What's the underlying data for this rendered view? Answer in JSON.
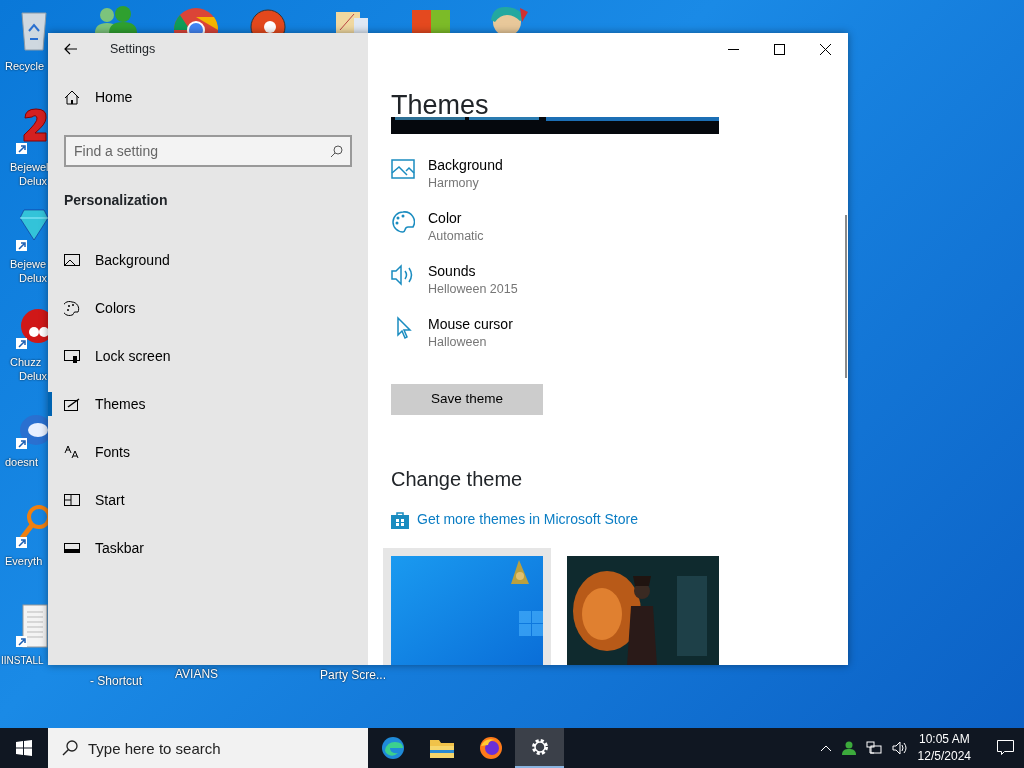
{
  "desktop": {
    "icons": [
      {
        "lines": [
          "Recycle"
        ]
      },
      {
        "lines": [
          "Bejewel",
          "Delux"
        ]
      },
      {
        "lines": [
          "Bejewe",
          "Delux"
        ]
      },
      {
        "lines": [
          "Chuzz",
          "Delux"
        ]
      },
      {
        "lines": [
          "doesnt"
        ]
      },
      {
        "lines": [
          "Everyth"
        ]
      },
      {
        "lines": [
          "IINSTALL"
        ]
      }
    ],
    "bottom_labels": [
      "- Shortcut",
      "AVIANS",
      "Party Scre..."
    ]
  },
  "window": {
    "title": "Settings",
    "home": "Home",
    "search": {
      "placeholder": "Find a setting"
    },
    "section": "Personalization",
    "nav": [
      {
        "label": "Background",
        "selected": false
      },
      {
        "label": "Colors",
        "selected": false
      },
      {
        "label": "Lock screen",
        "selected": false
      },
      {
        "label": "Themes",
        "selected": true
      },
      {
        "label": "Fonts",
        "selected": false
      },
      {
        "label": "Start",
        "selected": false
      },
      {
        "label": "Taskbar",
        "selected": false
      }
    ],
    "content": {
      "heading": "Themes",
      "settings": [
        {
          "name": "Background",
          "value": "Harmony"
        },
        {
          "name": "Color",
          "value": "Automatic"
        },
        {
          "name": "Sounds",
          "value": "Helloween 2015"
        },
        {
          "name": "Mouse cursor",
          "value": "Halloween"
        }
      ],
      "save_button": "Save theme",
      "change_heading": "Change theme",
      "store_link": "Get more themes in Microsoft Store",
      "themes": [
        {
          "kind": "picture",
          "selected": true
        },
        {
          "kind": "picture",
          "selected": false
        }
      ]
    }
  },
  "taskbar": {
    "search": {
      "placeholder": "Type here to search"
    },
    "apps": [
      {
        "selected": false
      },
      {
        "selected": false
      },
      {
        "selected": false
      },
      {
        "selected": true
      }
    ],
    "time": "10:05 AM",
    "date": "12/5/2024"
  }
}
